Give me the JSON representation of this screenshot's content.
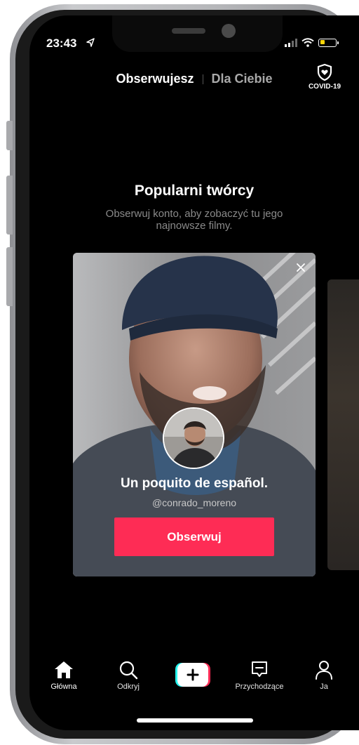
{
  "status_bar": {
    "time": "23:43"
  },
  "header": {
    "tab_following": "Obserwujesz",
    "tab_for_you": "Dla Ciebie",
    "covid_label": "COVID-19"
  },
  "section": {
    "title": "Popularni twórcy",
    "subtitle": "Obserwuj konto, aby zobaczyć tu jego najnowsze filmy."
  },
  "creator_card": {
    "title": "Un poquito de español.",
    "handle": "@conrado_moreno",
    "follow_label": "Obserwuj"
  },
  "bottom_nav": {
    "home": "Główna",
    "discover": "Odkryj",
    "inbox": "Przychodzące",
    "me": "Ja"
  },
  "colors": {
    "accent": "#fe2c55",
    "background": "#000000",
    "battery": "#ffd60a"
  },
  "icons": [
    "location-arrow-icon",
    "signal-icon",
    "wifi-icon",
    "battery-icon",
    "shield-heart-icon",
    "close-icon",
    "home-icon",
    "search-icon",
    "plus-icon",
    "inbox-icon",
    "profile-icon"
  ]
}
